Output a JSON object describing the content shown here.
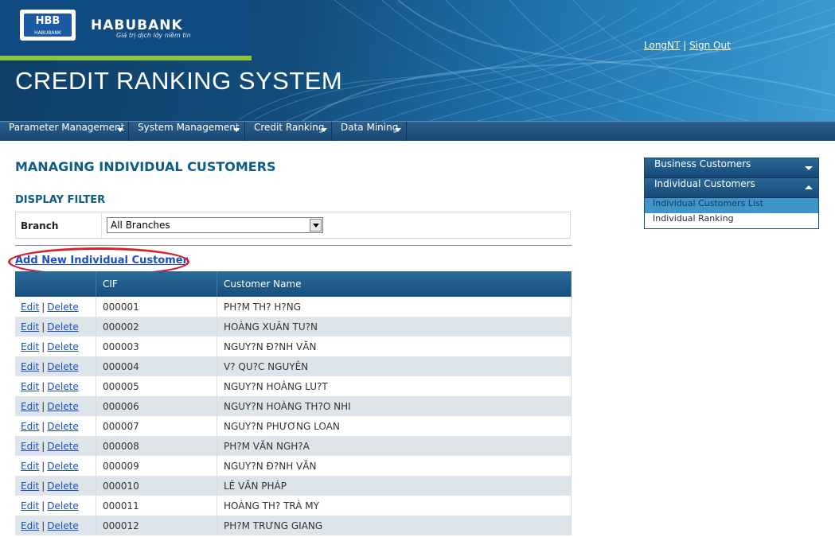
{
  "header": {
    "logo_mark": "HBB",
    "logo_mark_sub": "HABUBANK",
    "bank_name": "HABUBANK",
    "bank_slogan": "Giá trị dịch lớy niềm tin",
    "system_title": "CREDIT RANKING SYSTEM",
    "user": "LongNT",
    "separator": "|",
    "sign_out": "Sign Out"
  },
  "nav": {
    "items": [
      {
        "label": "Parameter Management"
      },
      {
        "label": "System Management"
      },
      {
        "label": "Credit Ranking"
      },
      {
        "label": "Data Mining"
      }
    ]
  },
  "main": {
    "page_title": "MANAGING INDIVIDUAL CUSTOMERS",
    "filter_title": "DISPLAY FILTER",
    "filter_label": "Branch",
    "branch_selected": "All Branches",
    "add_link": "Add New Individual Customer"
  },
  "table": {
    "columns": [
      "",
      "CIF",
      "Customer Name"
    ],
    "edit_label": "Edit",
    "delete_label": "Delete",
    "rows": [
      {
        "cif": "000001",
        "name": "PH?M TH? H?NG"
      },
      {
        "cif": "000002",
        "name": "HOÀNG XUÂN TU?N"
      },
      {
        "cif": "000003",
        "name": "NGUY?N Đ?NH VĂN"
      },
      {
        "cif": "000004",
        "name": "V? QU?C NGUYÊN"
      },
      {
        "cif": "000005",
        "name": "NGUY?N HOÀNG LU?T"
      },
      {
        "cif": "000006",
        "name": "NGUY?N HOÀNG TH?O NHI"
      },
      {
        "cif": "000007",
        "name": "NGUY?N PHƯƠNG LOAN"
      },
      {
        "cif": "000008",
        "name": "PH?M VĂN NGH?A"
      },
      {
        "cif": "000009",
        "name": "NGUY?N Đ?NH VĂN"
      },
      {
        "cif": "000010",
        "name": "LÊ VĂN PHÁP"
      },
      {
        "cif": "000011",
        "name": "HOÀNG TH? TRÀ MY"
      },
      {
        "cif": "000012",
        "name": "PH?M TRƯNG GIANG"
      }
    ]
  },
  "sidebar": {
    "business_customers": "Business Customers",
    "individual_customers": "Individual Customers",
    "items": [
      {
        "label": "Individual Customers List",
        "active": true
      },
      {
        "label": "Individual Ranking",
        "active": false
      }
    ]
  },
  "colors": {
    "accent": "#0e5d86",
    "link": "#1a4fc9",
    "highlight_ellipse": "#d8202a",
    "green_bar": "#8cc63e"
  }
}
